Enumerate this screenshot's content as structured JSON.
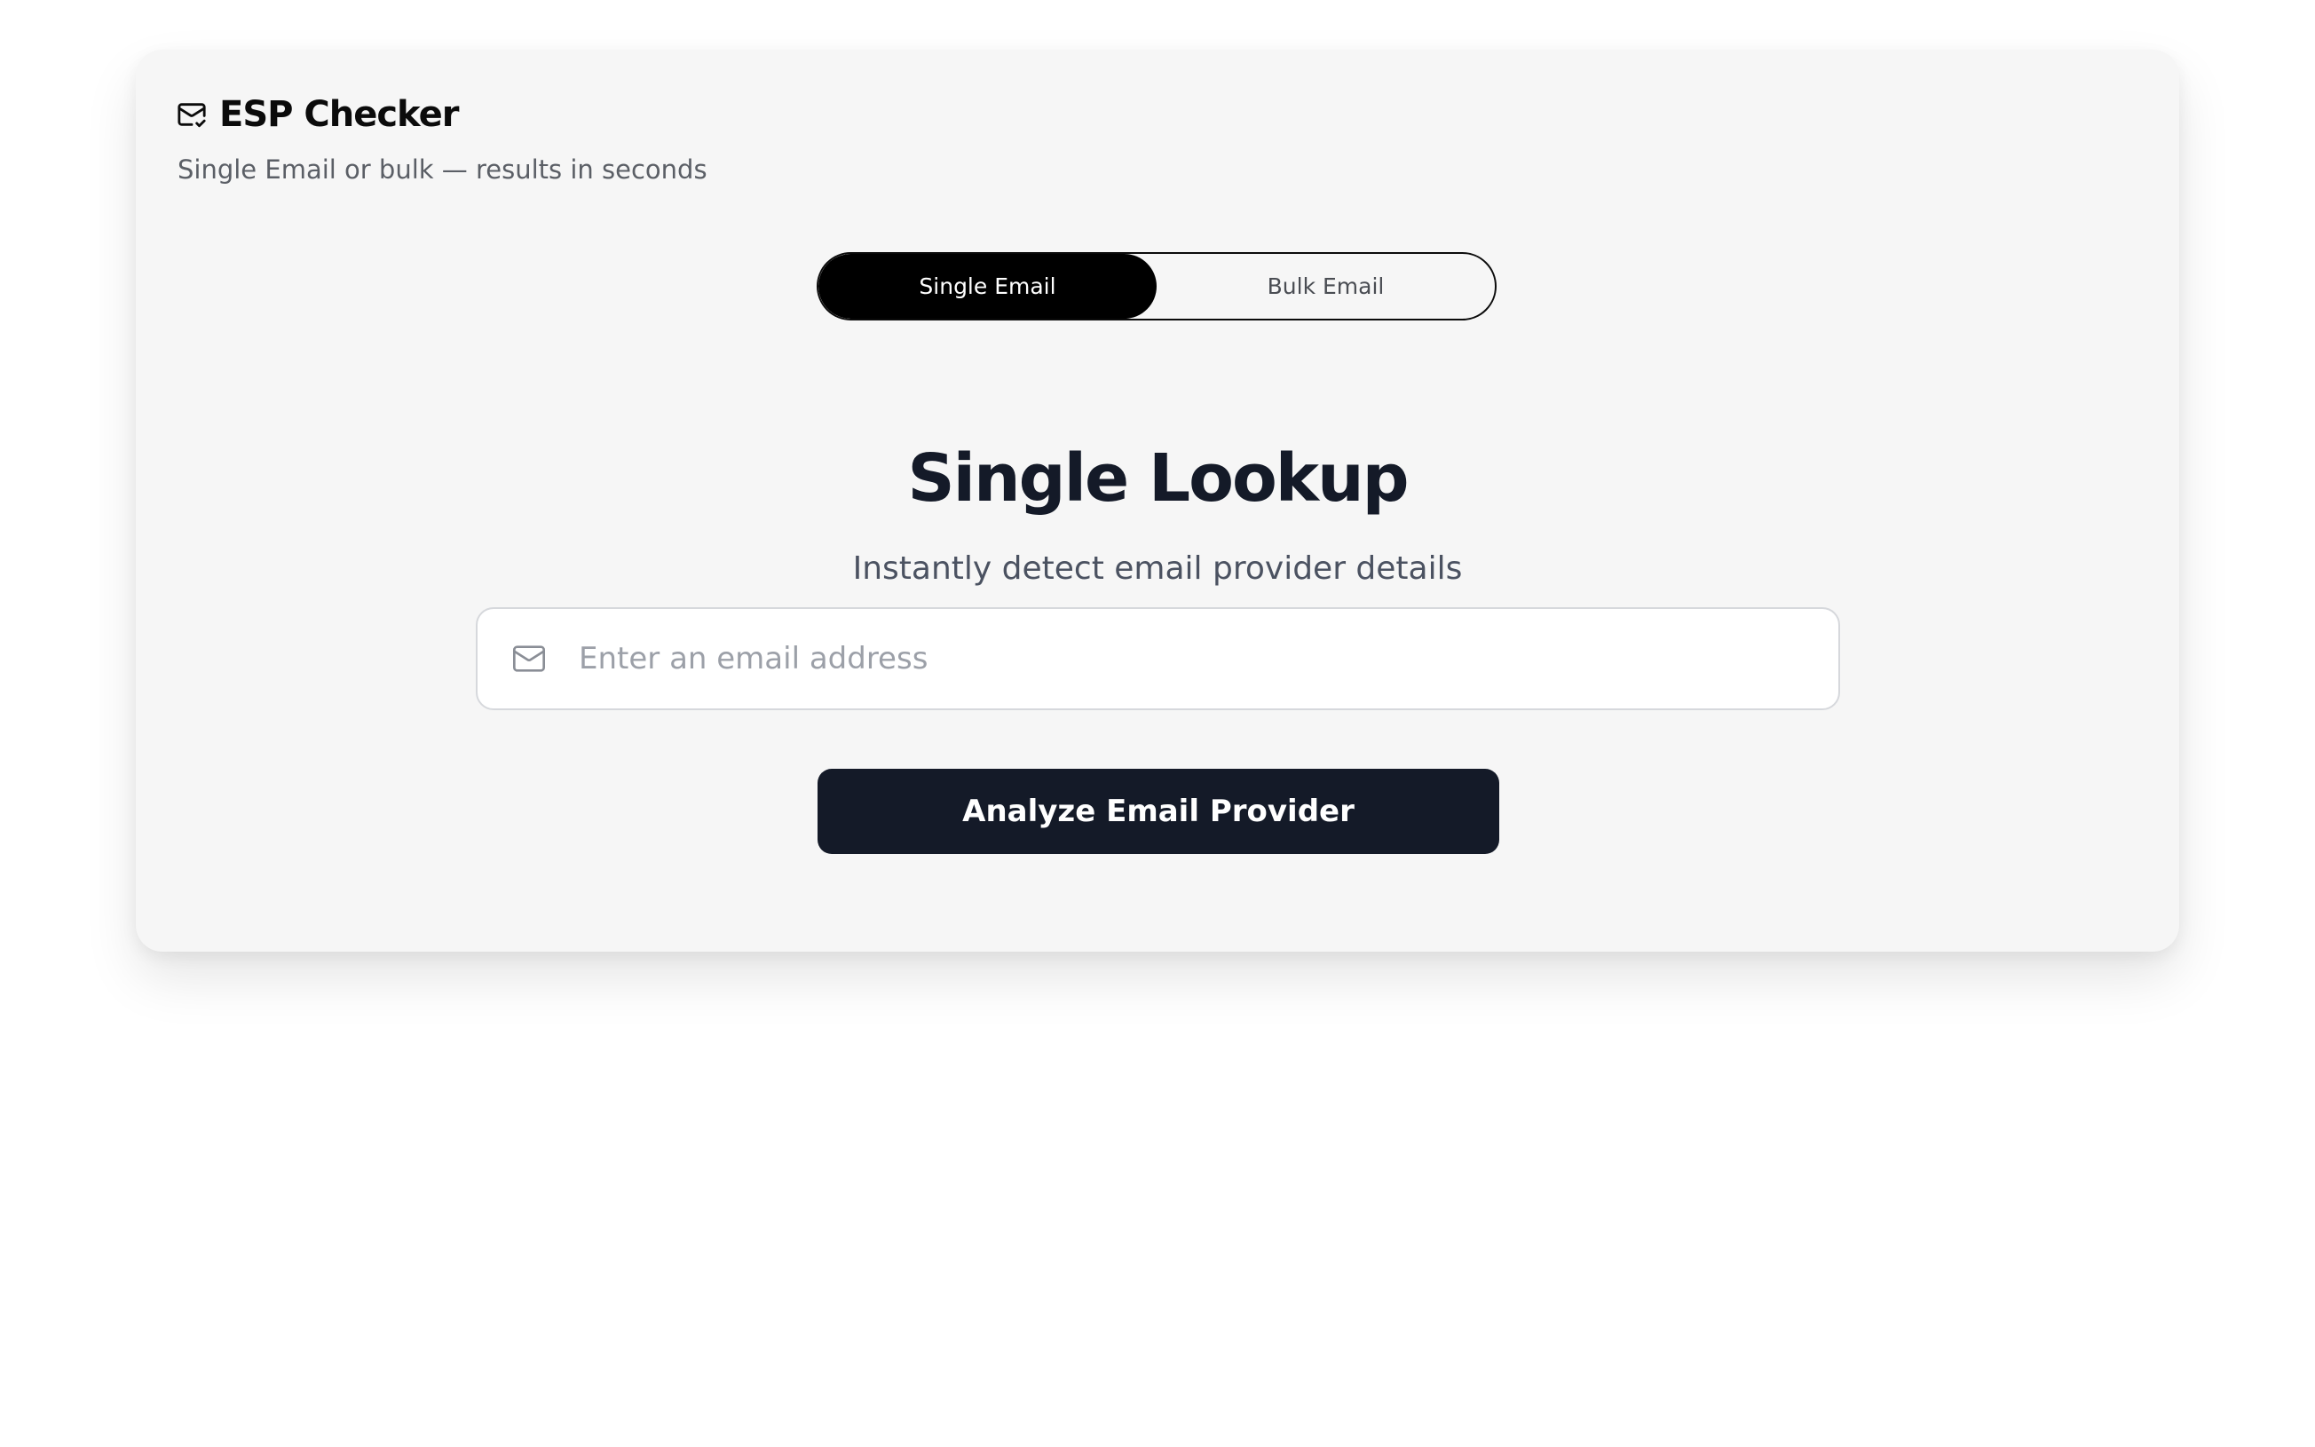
{
  "header": {
    "title": "ESP Checker",
    "subtitle": "Single Email or bulk — results in seconds",
    "icon": "mail-check-icon"
  },
  "mode_toggle": {
    "options": [
      {
        "label": "Single Email",
        "active": true
      },
      {
        "label": "Bulk Email",
        "active": false
      }
    ]
  },
  "main": {
    "title": "Single Lookup",
    "subtitle": "Instantly detect email provider details",
    "email_input": {
      "placeholder": "Enter an email address",
      "value": "",
      "icon": "mail-icon"
    },
    "submit_label": "Analyze Email Provider"
  },
  "colors": {
    "page_background": "#ffffff",
    "card_background": "#f6f6f6",
    "active_toggle": "#000000",
    "primary_button": "#141a28",
    "heading_text": "#141a28"
  }
}
